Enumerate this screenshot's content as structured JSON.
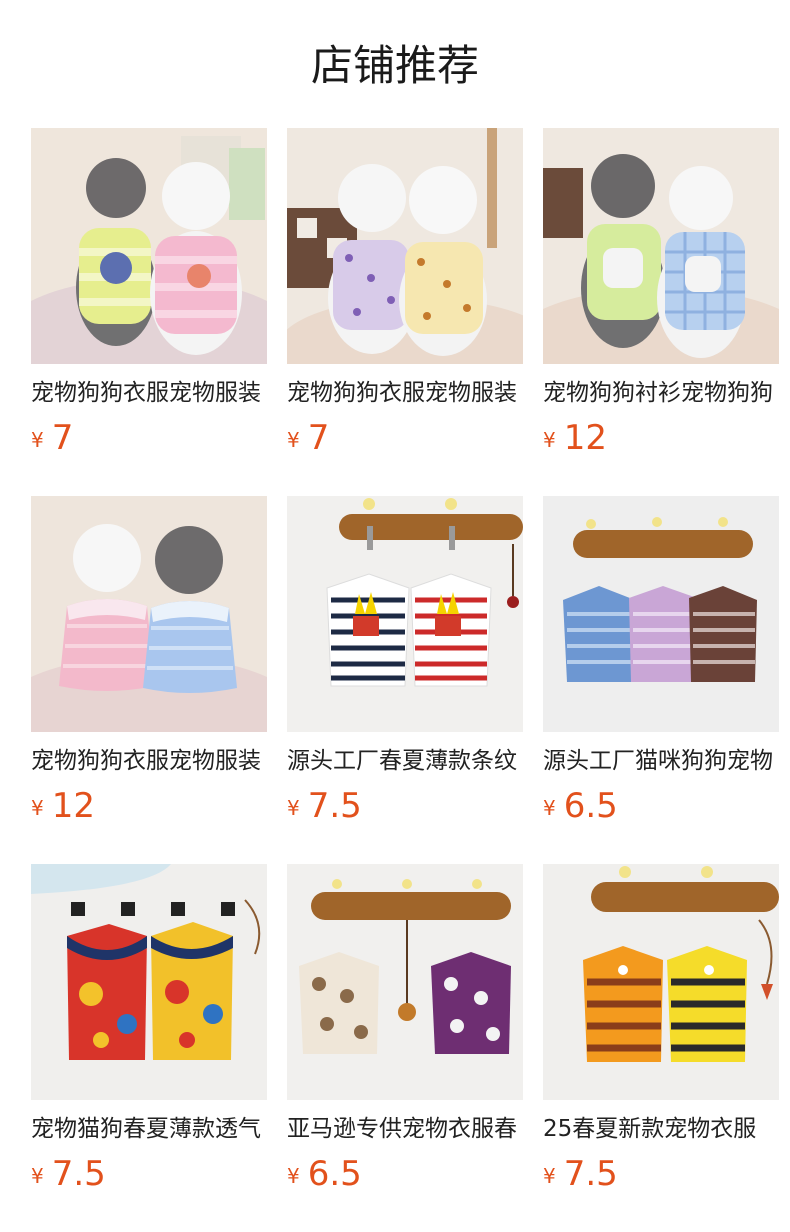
{
  "section": {
    "title": "店铺推荐"
  },
  "colors": {
    "price": "#e2511c",
    "title": "#1a1a1a",
    "name": "#222222",
    "background": "#ffffff"
  },
  "products": [
    {
      "name": "宠物狗狗衣服宠物服装",
      "currency": "¥",
      "price": "7"
    },
    {
      "name": "宠物狗狗衣服宠物服装",
      "currency": "¥",
      "price": "7"
    },
    {
      "name": "宠物狗狗衬衫宠物狗狗",
      "currency": "¥",
      "price": "12"
    },
    {
      "name": "宠物狗狗衣服宠物服装",
      "currency": "¥",
      "price": "12"
    },
    {
      "name": "源头工厂春夏薄款条纹",
      "currency": "¥",
      "price": "7.5"
    },
    {
      "name": "源头工厂猫咪狗狗宠物",
      "currency": "¥",
      "price": "6.5"
    },
    {
      "name": "宠物猫狗春夏薄款透气",
      "currency": "¥",
      "price": "7.5"
    },
    {
      "name": "亚马逊专供宠物衣服春",
      "currency": "¥",
      "price": "6.5"
    },
    {
      "name": "25春夏新款宠物衣服",
      "currency": "¥",
      "price": "7.5"
    }
  ]
}
